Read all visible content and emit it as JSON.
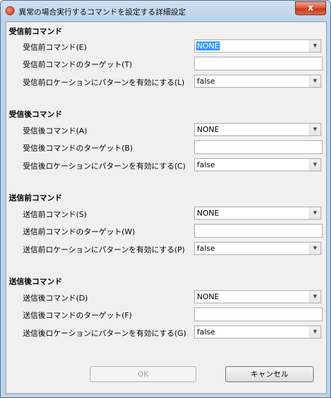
{
  "window": {
    "title": "異常の場合実行するコマンドを設定する詳細設定",
    "close_glyph": "x"
  },
  "sections": [
    {
      "title": "受信前コマンド",
      "command_label": "受信前コマンド(E)",
      "command_value": "NONE",
      "target_label": "受信前コマンドのターゲット(T)",
      "target_value": "",
      "pattern_label": "受信前ロケーションにパターンを有効にする(L)",
      "pattern_value": "false"
    },
    {
      "title": "受信後コマンド",
      "command_label": "受信後コマンド(A)",
      "command_value": "NONE",
      "target_label": "受信後コマンドのターゲット(B)",
      "target_value": "",
      "pattern_label": "受信後ロケーションにパターンを有効にする(C)",
      "pattern_value": "false"
    },
    {
      "title": "送信前コマンド",
      "command_label": "送信前コマンド(S)",
      "command_value": "NONE",
      "target_label": "送信前コマンドのターゲット(W)",
      "target_value": "",
      "pattern_label": "送信前ロケーションにパターンを有効にする(P)",
      "pattern_value": "false"
    },
    {
      "title": "送信後コマンド",
      "command_label": "送信後コマンド(D)",
      "command_value": "NONE",
      "target_label": "送信後コマンドのターゲット(F)",
      "target_value": "",
      "pattern_label": "送信後ロケーションにパターンを有効にする(G)",
      "pattern_value": "false"
    }
  ],
  "footer": {
    "ok_label": "OK",
    "cancel_label": "キャンセル"
  }
}
